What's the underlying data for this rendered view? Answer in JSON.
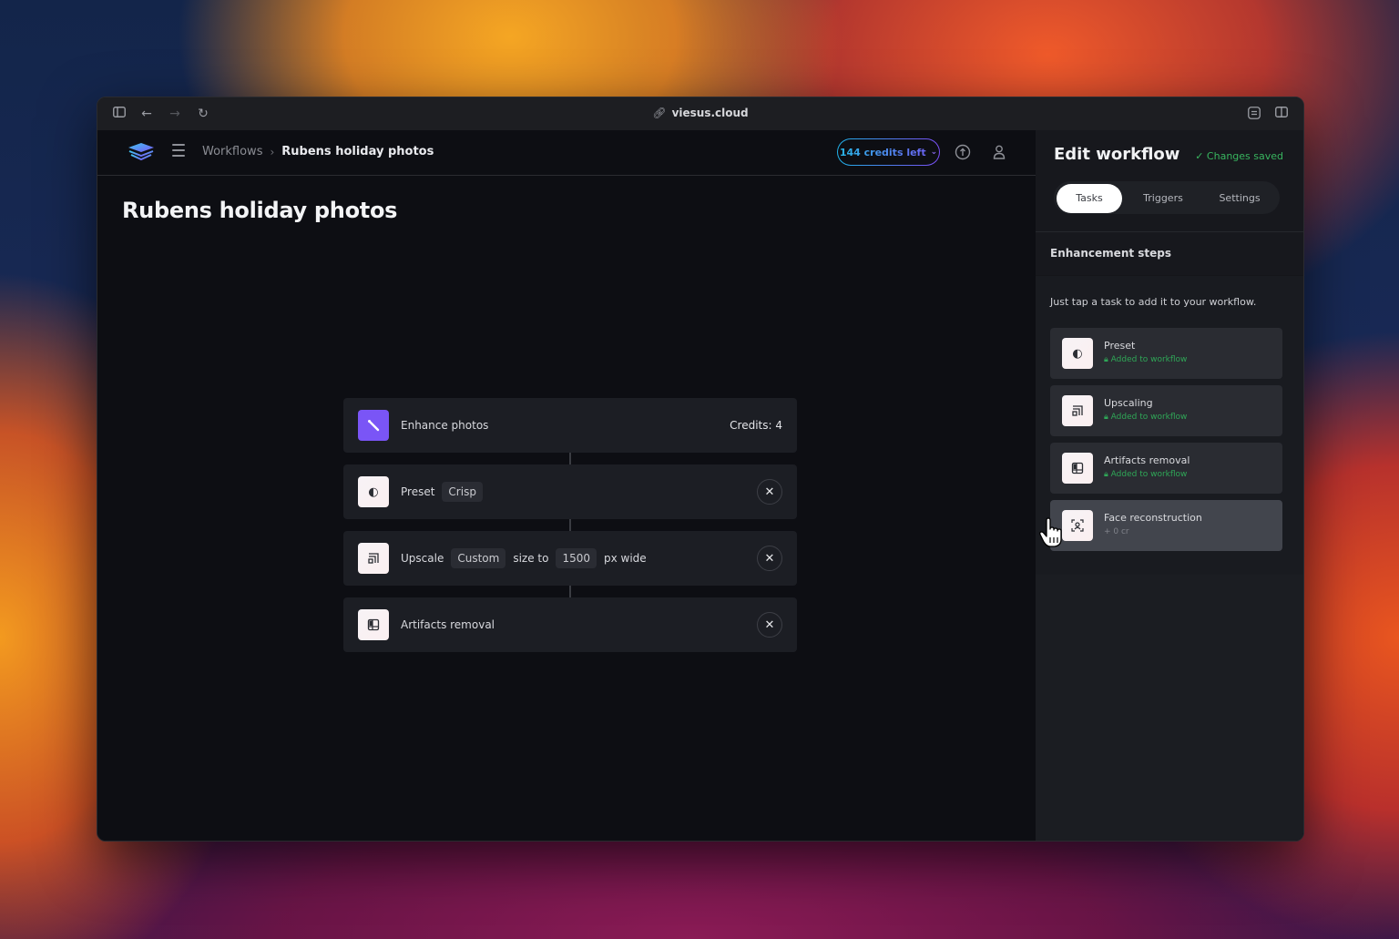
{
  "browser": {
    "url": "viesus.cloud",
    "icons": [
      "sidebar-toggle-icon",
      "back-icon",
      "forward-icon",
      "reload-icon",
      "link-icon",
      "reader-icon",
      "split-view-icon"
    ]
  },
  "nav": {
    "breadcrumb": {
      "parent": "Workflows",
      "separator": "›",
      "current": "Rubens holiday photos"
    },
    "credits_pill": "144 credits left",
    "colors": {
      "credits_gradient_start": "#1fb0e6",
      "credits_gradient_end": "#7b4df5"
    }
  },
  "main": {
    "title": "Rubens holiday photos",
    "workflow": {
      "header": {
        "label": "Enhance photos",
        "credits": "Credits: 4",
        "icon": "magic-wand-icon",
        "accent": "#7a55f6"
      },
      "steps": [
        {
          "label": "Preset",
          "icon": "preset-icon",
          "chips": [
            "Crisp"
          ]
        },
        {
          "label": "Upscale",
          "icon": "upscale-icon",
          "chip_mode": "Custom",
          "text_mid": "size to",
          "chip_value": "1500",
          "text_end": "px wide"
        },
        {
          "label": "Artifacts removal",
          "icon": "artifacts-icon"
        }
      ]
    }
  },
  "panel": {
    "title": "Edit workflow",
    "status": "Changes saved",
    "status_color": "#38b55f",
    "tabs": [
      {
        "label": "Tasks",
        "active": true
      },
      {
        "label": "Triggers",
        "active": false
      },
      {
        "label": "Settings",
        "active": false
      }
    ],
    "section_title": "Enhancement steps",
    "hint": "Just tap a task to add it to your workflow.",
    "tasks": [
      {
        "name": "Preset",
        "sub": "Added to workflow",
        "added": true,
        "icon": "preset-icon"
      },
      {
        "name": "Upscaling",
        "sub": "Added to workflow",
        "added": true,
        "icon": "upscale-icon"
      },
      {
        "name": "Artifacts removal",
        "sub": "Added to workflow",
        "added": true,
        "icon": "artifacts-icon"
      },
      {
        "name": "Face reconstruction",
        "sub": "+ 0 cr",
        "added": false,
        "icon": "face-icon",
        "hovered": true
      }
    ]
  }
}
